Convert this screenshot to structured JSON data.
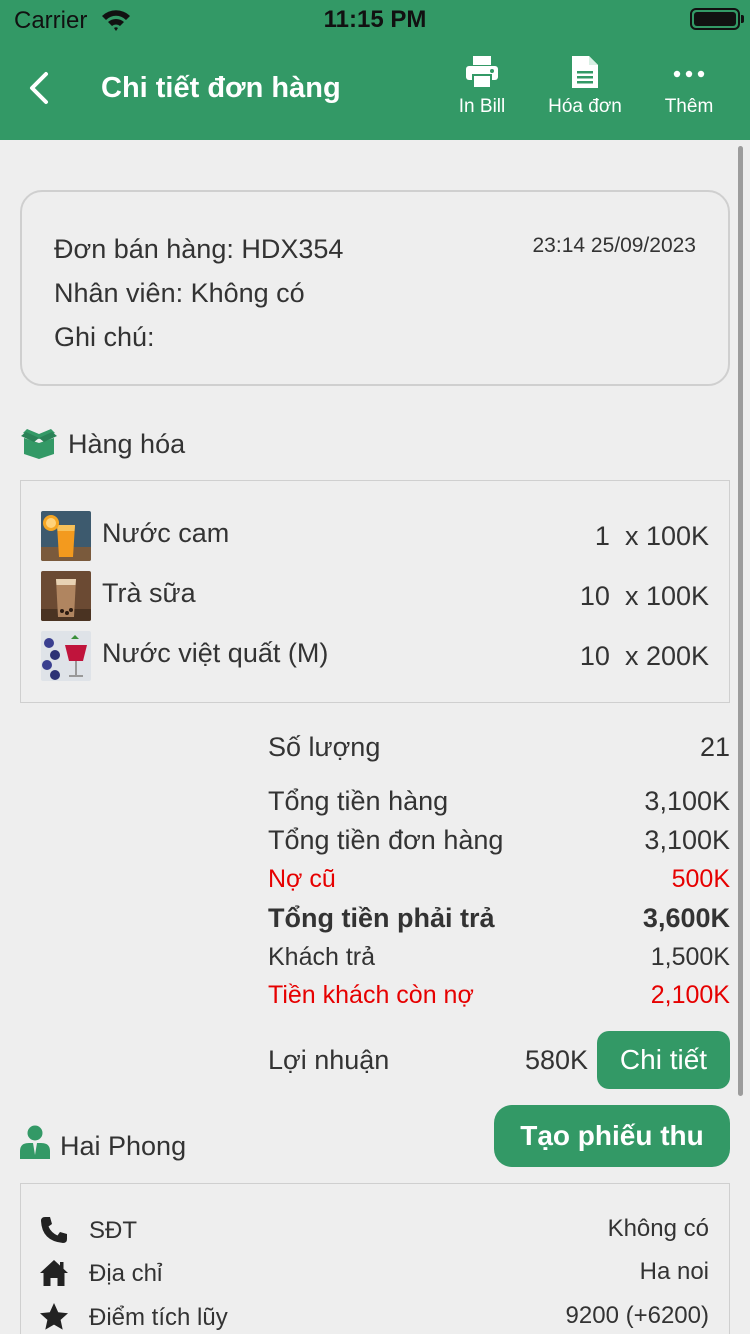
{
  "status_bar": {
    "carrier": "Carrier",
    "time": "11:15 PM"
  },
  "nav": {
    "title": "Chi tiết đơn hàng",
    "actions": [
      {
        "label": "In Bill",
        "icon": "printer-icon"
      },
      {
        "label": "Hóa đơn",
        "icon": "document-icon"
      },
      {
        "label": "Thêm",
        "icon": "more-icon"
      }
    ]
  },
  "order": {
    "code": "Đơn bán hàng: HDX354",
    "employee": "Nhân viên: Không có",
    "note": "Ghi chú:",
    "datetime": "23:14 25/09/2023"
  },
  "goods": {
    "title": "Hàng hóa",
    "items": [
      {
        "name": "Nước cam",
        "qty": "1  x 100K",
        "thumb": "orange-juice"
      },
      {
        "name": "Trà sữa",
        "qty": "10  x 100K",
        "thumb": "milk-tea"
      },
      {
        "name": "Nước việt quất (M)",
        "qty": "10  x 200K",
        "thumb": "blueberry-drink"
      }
    ]
  },
  "summary": {
    "quantity": {
      "label": "Số lượng",
      "value": "21"
    },
    "goods_total": {
      "label": "Tổng tiền hàng",
      "value": "3,100K"
    },
    "order_total": {
      "label": "Tổng tiền đơn hàng",
      "value": "3,100K"
    },
    "old_debt": {
      "label": "Nợ cũ",
      "value": "500K"
    },
    "total_due": {
      "label": "Tổng tiền phải trả",
      "value": "3,600K"
    },
    "customer_paid": {
      "label": "Khách trả",
      "value": "1,500K"
    },
    "remaining_debt": {
      "label": "Tiền khách còn nợ",
      "value": "2,100K"
    },
    "profit": {
      "label": "Lợi nhuận",
      "value": "580K",
      "button": "Chi tiết"
    }
  },
  "customer": {
    "name": "Hai Phong",
    "create_receipt_button": "Tạo phiếu thu",
    "rows": [
      {
        "icon": "phone-icon",
        "label": "SĐT",
        "value": "Không có"
      },
      {
        "icon": "home-icon",
        "label": "Địa chỉ",
        "value": "Ha noi"
      },
      {
        "icon": "star-icon",
        "label": "Điểm tích lũy",
        "value": "9200 (+6200)"
      }
    ]
  },
  "colors": {
    "primary": "#339966",
    "danger": "#e60000",
    "background": "#eeeeee"
  }
}
